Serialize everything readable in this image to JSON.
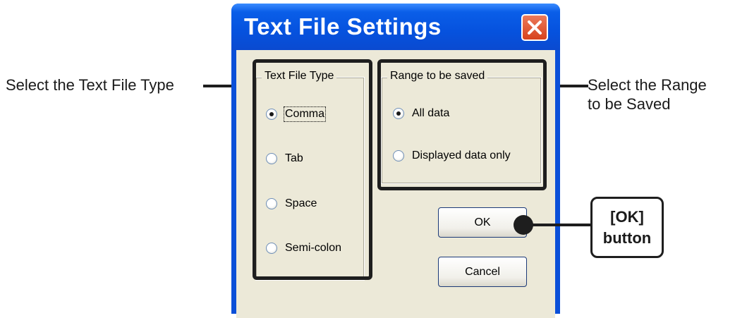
{
  "window": {
    "title": "Text File Settings"
  },
  "text_file_type": {
    "label": "Text File Type",
    "options": [
      {
        "label": "Comma",
        "checked": true
      },
      {
        "label": "Tab",
        "checked": false
      },
      {
        "label": "Space",
        "checked": false
      },
      {
        "label": "Semi-colon",
        "checked": false
      }
    ]
  },
  "range_to_be_saved": {
    "label": "Range to be saved",
    "options": [
      {
        "label": "All data",
        "checked": true
      },
      {
        "label": "Displayed data only",
        "checked": false
      }
    ]
  },
  "buttons": {
    "ok": "OK",
    "cancel": "Cancel"
  },
  "annotations": {
    "type_callout": "Select the Text File Type",
    "range_callout_line1": "Select the Range",
    "range_callout_line2": "to be Saved",
    "ok_callout_line1": "[OK]",
    "ok_callout_line2": "button"
  },
  "colors": {
    "titlebar": "#0652de",
    "client_bg": "#ece9d8",
    "close_button": "#d6421d",
    "callout": "#1e1e1e"
  },
  "icons": {
    "close": "close-x-icon"
  }
}
